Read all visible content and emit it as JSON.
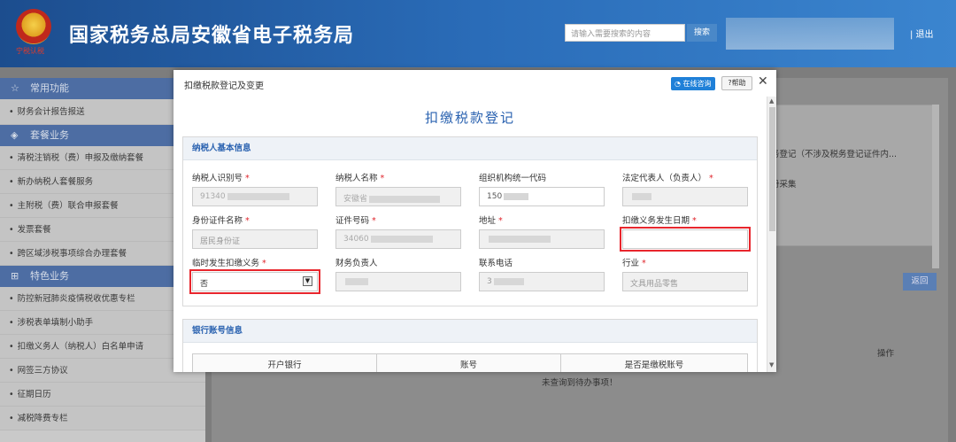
{
  "header": {
    "site_title": "国家税务总局安徽省电子税务局",
    "emblem_text": "宁税认税",
    "search_placeholder": "请输入需要搜索的内容",
    "search_button": "搜索",
    "logout": "| 退出"
  },
  "sidebar": {
    "sections": [
      {
        "label": "常用功能",
        "icon": "star-icon",
        "items": [
          "财务会计报告报送"
        ]
      },
      {
        "label": "套餐业务",
        "icon": "layers-icon",
        "items": [
          "清税注销税（费）申报及缴纳套餐",
          "新办纳税人套餐服务",
          "主附税（费）联合申报套餐",
          "发票套餐",
          "跨区域涉税事项综合办理套餐"
        ]
      },
      {
        "label": "特色业务",
        "icon": "grid-icon",
        "items": [
          "防控新冠肺炎疫情税收优惠专栏",
          "涉税表单填制小助手",
          "扣缴义务人（纳税人）白名单申请",
          "网签三方协议",
          "征期日历",
          "减税降费专栏"
        ]
      }
    ]
  },
  "background": {
    "text1": "务登记（不涉及税务登记证件内...",
    "text2": "册采集",
    "back_button": "返回",
    "op_header": "操作",
    "no_items": "未查询到待办事项！"
  },
  "modal": {
    "title": "扣缴税款登记及变更",
    "online_button": "在线咨询",
    "help_button": "?帮助",
    "close": "✕",
    "form_title": "扣缴税款登记",
    "section1_title": "纳税人基本信息",
    "section2_title": "银行账号信息",
    "fields": {
      "taxpayer_id": {
        "label": "纳税人识别号",
        "value": "91340"
      },
      "taxpayer_name": {
        "label": "纳税人名称",
        "value": "安徽省"
      },
      "org_code": {
        "label": "组织机构统一代码",
        "value": "150"
      },
      "legal_rep": {
        "label": "法定代表人（负责人）",
        "value": ""
      },
      "id_type": {
        "label": "身份证件名称",
        "value": "居民身份证"
      },
      "id_number": {
        "label": "证件号码",
        "value": "34060"
      },
      "address": {
        "label": "地址",
        "value": ""
      },
      "obligation_date": {
        "label": "扣缴义务发生日期",
        "value": ""
      },
      "temp_obligation": {
        "label": "临时发生扣缴义务",
        "value": "否"
      },
      "finance_head": {
        "label": "财务负责人",
        "value": ""
      },
      "phone": {
        "label": "联系电话",
        "value": "3"
      },
      "industry": {
        "label": "行业",
        "value": "文具用品零售"
      }
    },
    "bank_table": {
      "headers": [
        "开户银行",
        "账号",
        "是否是缴税账号"
      ]
    }
  }
}
